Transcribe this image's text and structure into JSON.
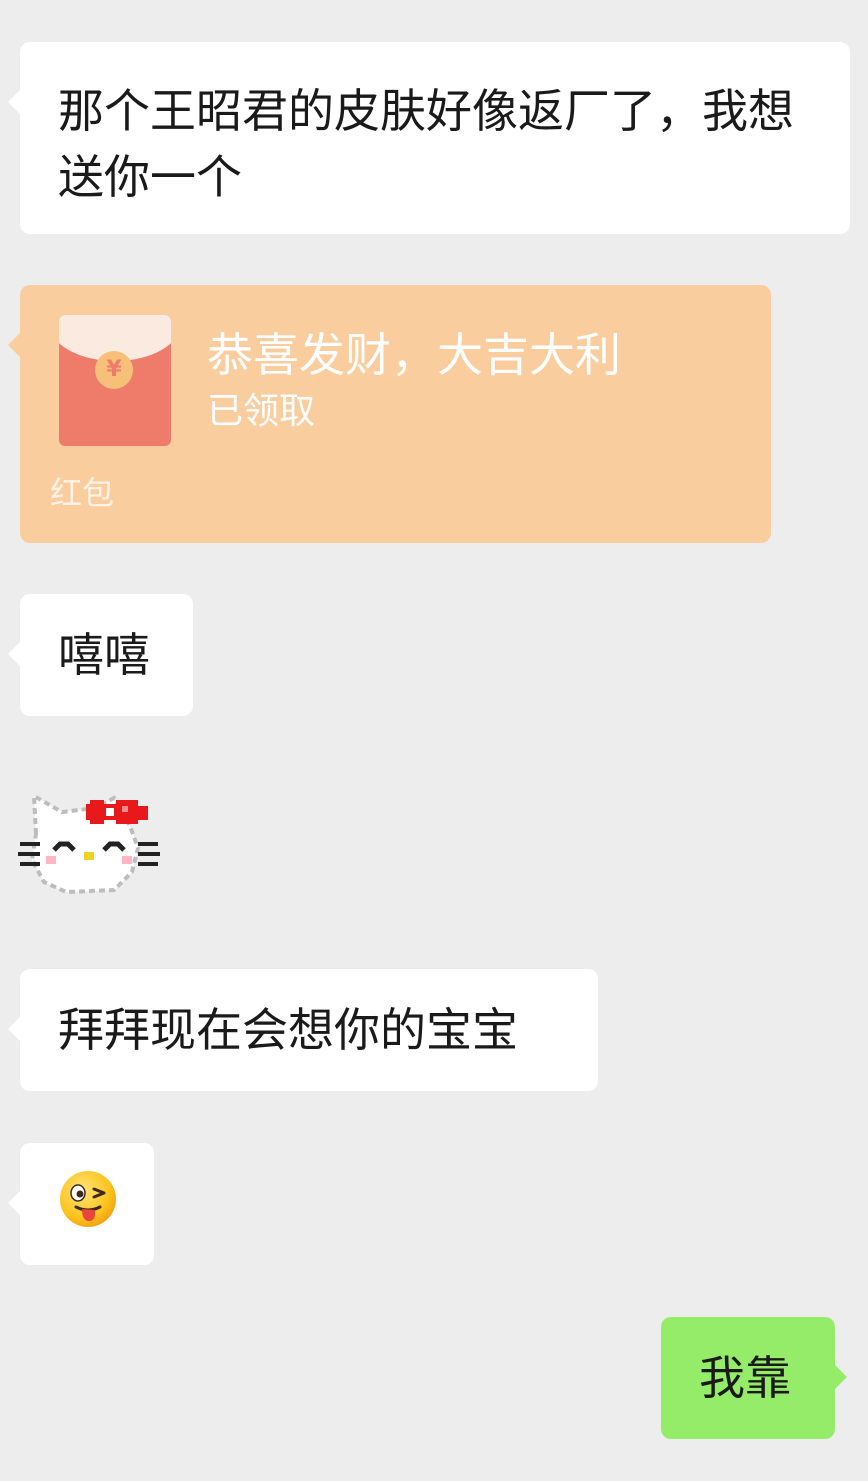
{
  "messages": [
    {
      "side": "left",
      "type": "text",
      "text": "那个王昭君的皮肤好像返厂了，我想送你一个"
    },
    {
      "side": "left",
      "type": "red_packet",
      "title": "恭喜发财，大吉大利",
      "status": "已领取",
      "label": "红包",
      "coin_symbol": "¥",
      "colors": {
        "card": "#facd9f",
        "envelope": "#ef7c6b"
      }
    },
    {
      "side": "left",
      "type": "text",
      "text": "嘻嘻"
    },
    {
      "side": "left",
      "type": "sticker",
      "sticker": "hello-kitty-pixel-sticker"
    },
    {
      "side": "left",
      "type": "text",
      "text": "拜拜现在会想你的宝宝"
    },
    {
      "side": "left",
      "type": "emoji",
      "emoji": "winking-face-with-tongue"
    },
    {
      "side": "right",
      "type": "text",
      "text": "我靠"
    }
  ],
  "colors": {
    "background": "#ededed",
    "incoming_bubble": "#ffffff",
    "outgoing_bubble": "#95ec69",
    "text": "#1a1a1a"
  }
}
